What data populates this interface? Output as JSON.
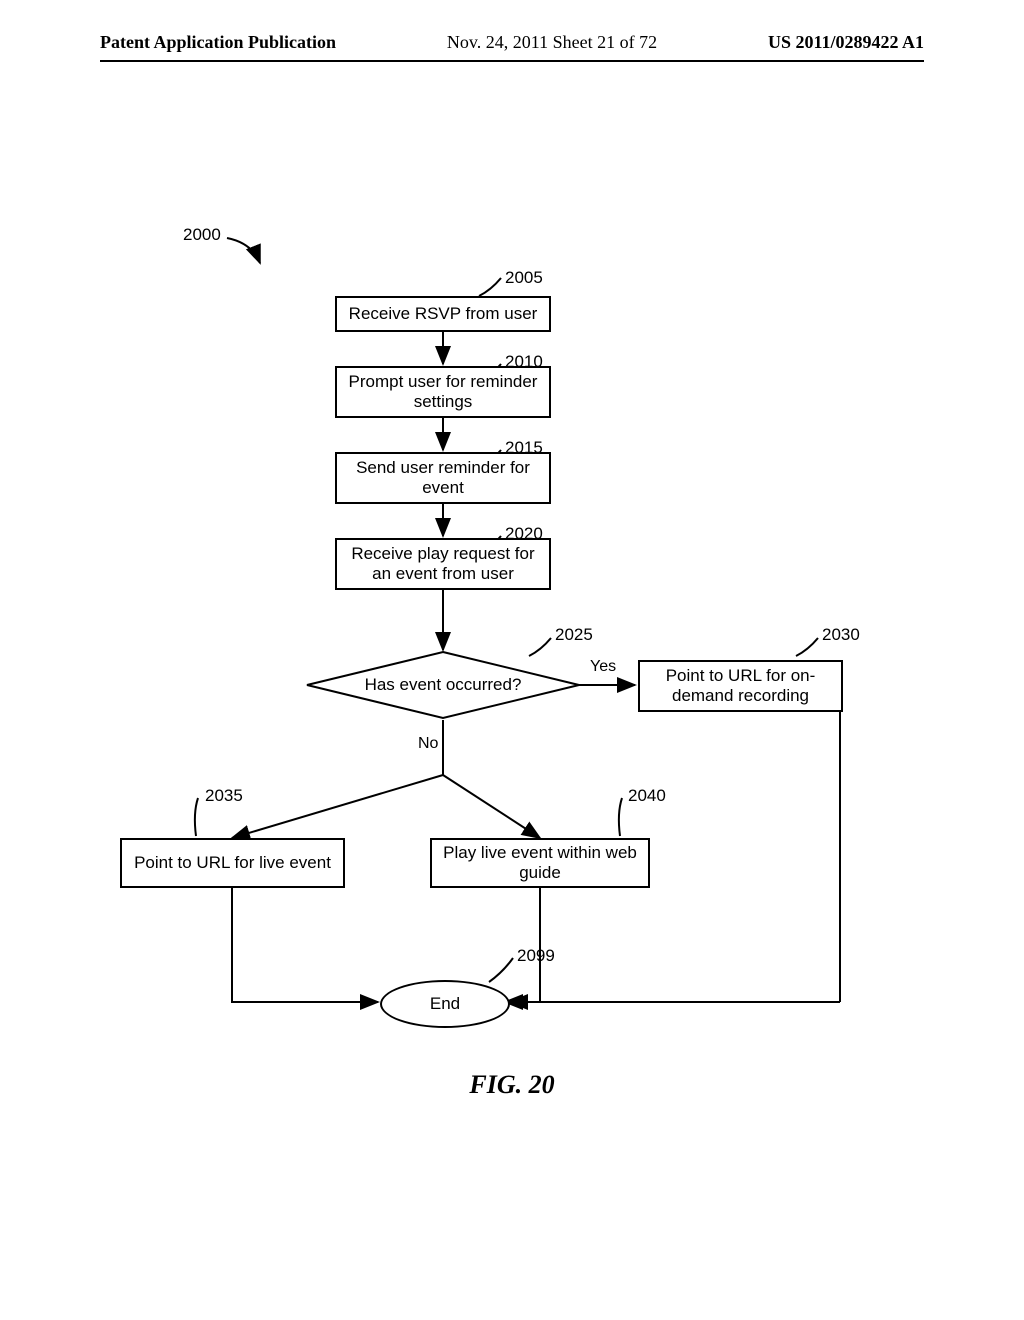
{
  "header": {
    "left": "Patent Application Publication",
    "center": "Nov. 24, 2011  Sheet 21 of 72",
    "right": "US 2011/0289422 A1"
  },
  "figure": {
    "caption": "FIG. 20",
    "ref_root": {
      "num": "2000"
    },
    "nodes": {
      "n2005": {
        "ref": "2005",
        "text": "Receive RSVP from user"
      },
      "n2010": {
        "ref": "2010",
        "text": "Prompt user for reminder settings"
      },
      "n2015": {
        "ref": "2015",
        "text": "Send user reminder for event"
      },
      "n2020": {
        "ref": "2020",
        "text": "Receive play request for an event from user"
      },
      "n2025": {
        "ref": "2025",
        "text": "Has event occurred?"
      },
      "n2030": {
        "ref": "2030",
        "text": "Point to URL for on-demand recording"
      },
      "n2035": {
        "ref": "2035",
        "text": "Point to URL for live event"
      },
      "n2040": {
        "ref": "2040",
        "text": "Play live event within web guide"
      },
      "n2099": {
        "ref": "2099",
        "text": "End"
      }
    },
    "edges": {
      "yes": "Yes",
      "no": "No"
    }
  }
}
